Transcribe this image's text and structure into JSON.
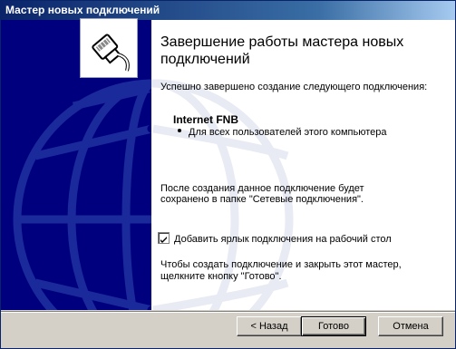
{
  "window": {
    "title": "Мастер новых подключений"
  },
  "heading": "Завершение работы мастера новых подключений",
  "success_text": "Успешно завершено создание следующего подключения:",
  "connection": {
    "name": "Internet FNB",
    "detail": "Для всех пользователей этого компьютера"
  },
  "save_text_line1": "После создания данное подключение будет",
  "save_text_line2": "сохранено в папке \"Сетевые подключения\".",
  "shortcut_checkbox": {
    "label": "Добавить ярлык подключения на рабочий стол",
    "checked": true
  },
  "finish_text_line1": "Чтобы создать подключение и закрыть этот мастер,",
  "finish_text_line2": "щелкните кнопку \"Готово\".",
  "buttons": {
    "back": "< Назад",
    "finish": "Готово",
    "cancel": "Отмена"
  },
  "colors": {
    "sidebar": "#00007f",
    "titlebar": "#0a246a"
  },
  "icons": {
    "side": "network-cable-icon",
    "globe": "globe-graphic"
  }
}
